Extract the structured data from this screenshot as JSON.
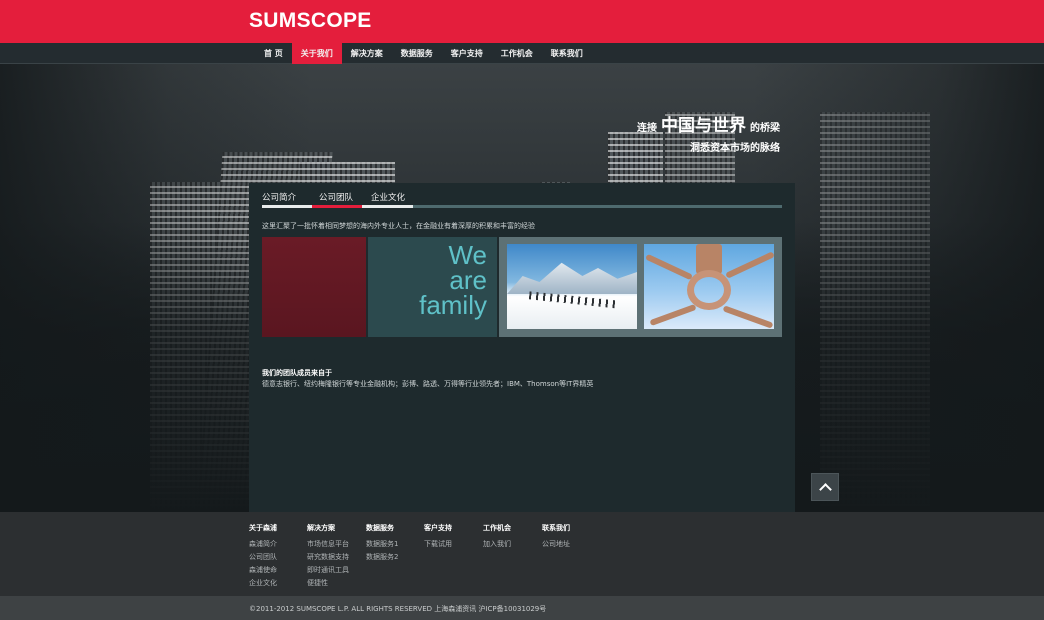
{
  "header": {
    "logo": "SUMSCOPE",
    "brand_color": "#e41e3c"
  },
  "nav": {
    "items": [
      {
        "label": "首 页",
        "active": false
      },
      {
        "label": "关于我们",
        "active": true
      },
      {
        "label": "解决方案",
        "active": false
      },
      {
        "label": "数据服务",
        "active": false
      },
      {
        "label": "客户支持",
        "active": false
      },
      {
        "label": "工作机会",
        "active": false
      },
      {
        "label": "联系我们",
        "active": false
      }
    ]
  },
  "hero": {
    "tagline_prefix": "连接",
    "tagline_big": "中国与世界",
    "tagline_suffix": "的桥梁",
    "tagline_line2": "洞悉资本市场的脉络"
  },
  "content": {
    "tabs": [
      {
        "label": "公司简介",
        "active": false
      },
      {
        "label": "公司团队",
        "active": true
      },
      {
        "label": "企业文化",
        "active": false
      }
    ],
    "intro": "这里汇聚了一批怀着相同梦想的海内外专业人士，在金融业有着深厚的积累和丰富的经验",
    "banner_text": [
      "We",
      "are",
      "family"
    ],
    "team_title": "我们的团队成员来自于",
    "team_desc": "德意志银行、纽约梅隆银行等专业金融机构；彭博、路透、万得等行业领先者；IBM、Thomson等IT界精英"
  },
  "footer": {
    "columns": [
      {
        "heading": "关于森浦",
        "items": [
          "森浦简介",
          "公司团队",
          "森浦使命",
          "企业文化"
        ]
      },
      {
        "heading": "解决方案",
        "items": [
          "市场信息平台",
          "研究数据支持",
          "即时通讯工具",
          "便捷性"
        ]
      },
      {
        "heading": "数据服务",
        "items": [
          "数据服务1",
          "数据服务2"
        ]
      },
      {
        "heading": "客户支持",
        "items": [
          "下载试用"
        ]
      },
      {
        "heading": "工作机会",
        "items": [
          "加入我们"
        ]
      },
      {
        "heading": "联系我们",
        "items": [
          "公司地址"
        ]
      }
    ],
    "copyright": "©2011-2012 SUMSCOPE L.P. ALL RIGHTS RESERVED   上海森浦资讯   沪ICP备10031029号"
  },
  "icons": {
    "back_to_top": "chevron-up-icon"
  }
}
